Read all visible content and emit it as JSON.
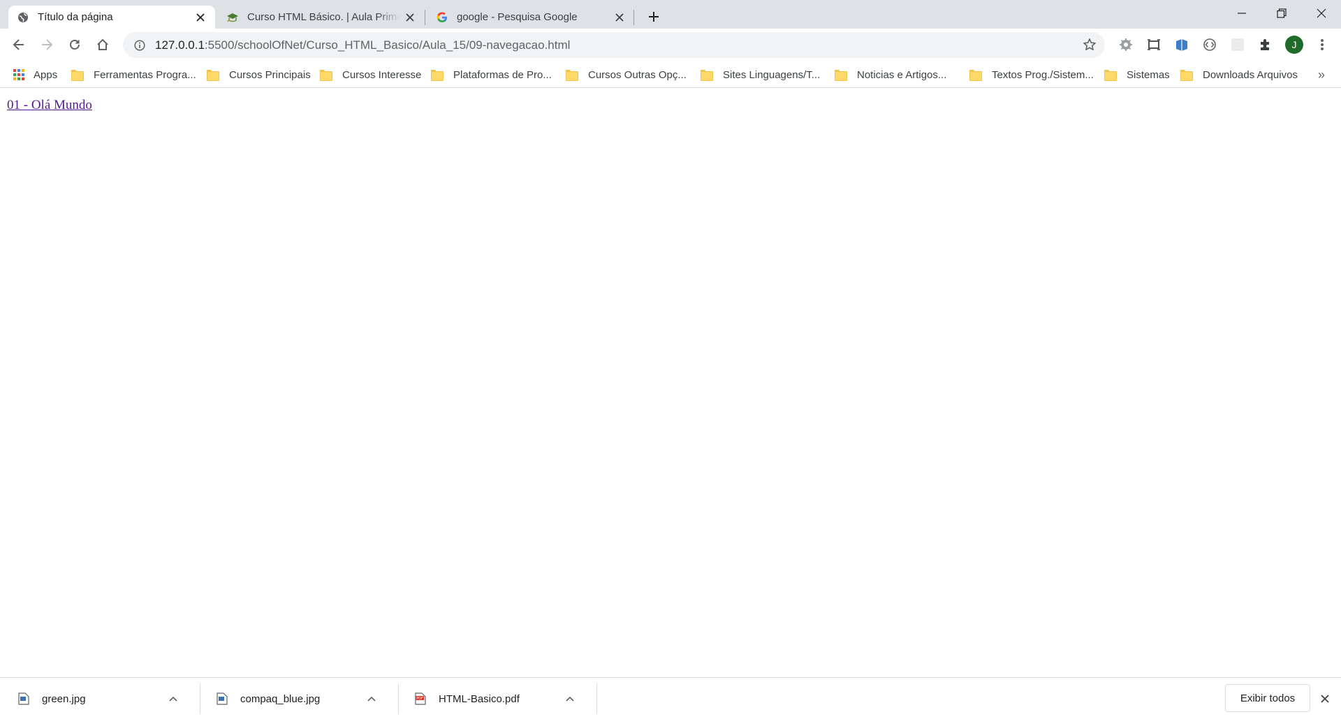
{
  "tabs": [
    {
      "title": "Título da página",
      "active": true,
      "icon": "globe-icon"
    },
    {
      "title": "Curso HTML Básico. | Aula Primeira",
      "active": false,
      "icon": "course-favicon-icon"
    },
    {
      "title": "google - Pesquisa Google",
      "active": false,
      "icon": "google-g-icon"
    }
  ],
  "address_bar": {
    "url_host": "127.0.0.1",
    "url_rest": ":5500/schoolOfNet/Curso_HTML_Basico/Aula_15/09-navegacao.html"
  },
  "profile": {
    "initial": "J"
  },
  "bookmarks": {
    "apps_label": "Apps",
    "items": [
      "Ferramentas Progra...",
      "Cursos Principais",
      "Cursos Interesse",
      "Plataformas de Pro...",
      "Cursos Outras Opç...",
      "Sites Linguagens/T...",
      "Noticias e Artigos...",
      "Textos Prog./Sistem...",
      "Sistemas",
      "Downloads Arquivos"
    ],
    "more": "»"
  },
  "page": {
    "link_text": "01 - Olá Mundo"
  },
  "downloads": {
    "items": [
      {
        "name": "green.jpg",
        "type": "image"
      },
      {
        "name": "compaq_blue.jpg",
        "type": "image"
      },
      {
        "name": "HTML-Basico.pdf",
        "type": "pdf"
      }
    ],
    "show_all_label": "Exibir todos"
  },
  "colors": {
    "tabstrip_bg": "#dee1e6",
    "link_visited": "#551a8b",
    "avatar_bg": "#1e6b2a",
    "folder_yellow": "#fcd968"
  }
}
